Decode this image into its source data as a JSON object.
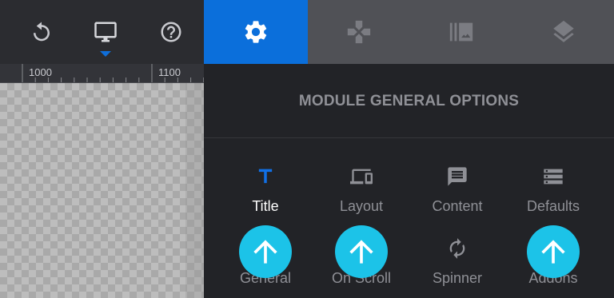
{
  "toolbar": {
    "undo_icon": "undo-icon",
    "desktop_icon": "desktop-icon",
    "help_icon": "help-icon",
    "active_color": "#0f6ed9"
  },
  "ruler": {
    "labels": [
      "1000",
      "1100"
    ]
  },
  "tabs": [
    {
      "icon": "gear-icon",
      "active": true
    },
    {
      "icon": "gamepad-icon",
      "active": false
    },
    {
      "icon": "gallery-icon",
      "active": false
    },
    {
      "icon": "layers-icon",
      "active": false
    }
  ],
  "panel": {
    "title": "MODULE GENERAL OPTIONS",
    "row1": [
      {
        "label": "Title",
        "icon": "title-t-icon",
        "active": true
      },
      {
        "label": "Layout",
        "icon": "devices-icon",
        "active": false
      },
      {
        "label": "Content",
        "icon": "message-icon",
        "active": false
      },
      {
        "label": "Defaults",
        "icon": "storage-icon",
        "active": false
      }
    ],
    "row2": [
      {
        "label": "General",
        "icon": "up-arrow-icon"
      },
      {
        "label": "On Scroll",
        "icon": "up-arrow-icon"
      },
      {
        "label": "Spinner",
        "icon": "refresh-icon"
      },
      {
        "label": "Addons",
        "icon": "up-arrow-icon"
      }
    ]
  },
  "colors": {
    "accent": "#0b6fdb",
    "badge": "#1cc3e8"
  }
}
